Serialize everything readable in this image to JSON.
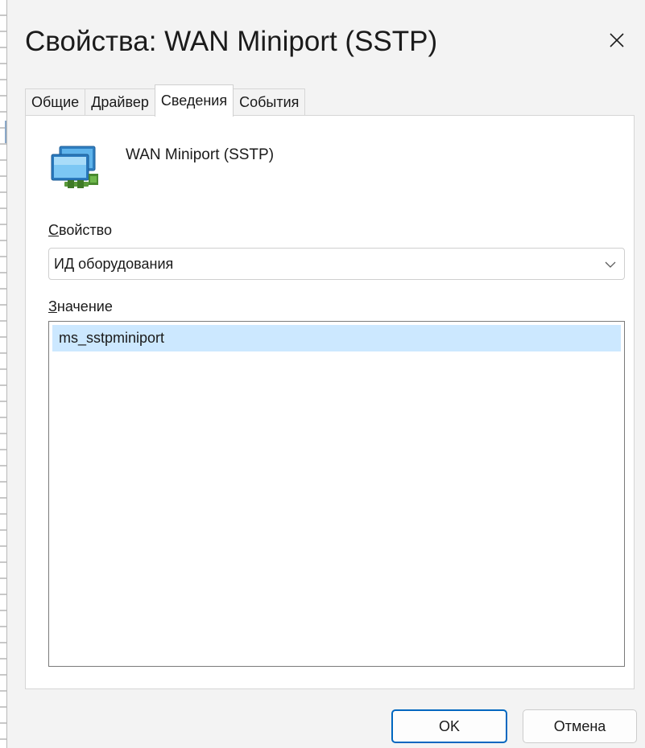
{
  "dialog": {
    "title": "Свойства: WAN Miniport (SSTP)",
    "close_icon": "close-icon"
  },
  "tabs": [
    {
      "label": "Общие",
      "active": false
    },
    {
      "label": "Драйвер",
      "active": false
    },
    {
      "label": "Сведения",
      "active": true
    },
    {
      "label": "События",
      "active": false
    }
  ],
  "device": {
    "icon": "network-adapter-icon",
    "name": "WAN Miniport (SSTP)"
  },
  "property": {
    "label_accel": "С",
    "label_rest": "войство",
    "selected": "ИД оборудования",
    "chevron_icon": "chevron-down-icon"
  },
  "value": {
    "label_accel": "З",
    "label_rest": "начение",
    "items": [
      "ms_sstpminiport"
    ]
  },
  "buttons": {
    "ok": "OK",
    "cancel": "Отмена"
  },
  "colors": {
    "selection": "#cce8ff",
    "accent": "#0067c0",
    "background": "#f3f3f3"
  }
}
